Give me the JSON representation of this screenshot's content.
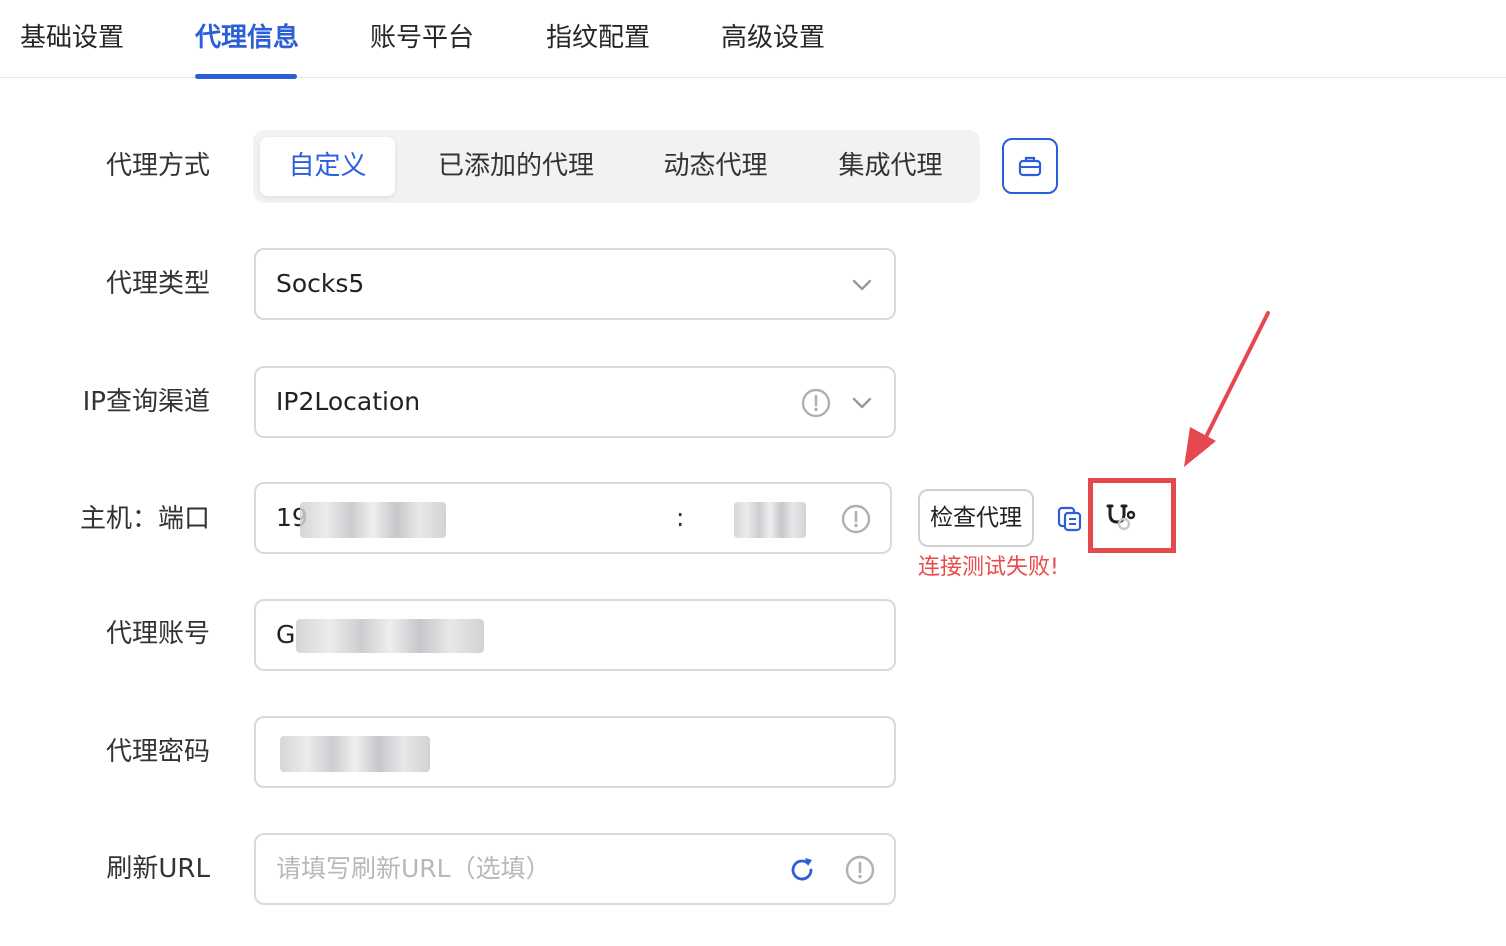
{
  "tabs": [
    {
      "label": "基础设置"
    },
    {
      "label": "代理信息"
    },
    {
      "label": "账号平台"
    },
    {
      "label": "指纹配置"
    },
    {
      "label": "高级设置"
    }
  ],
  "form": {
    "proxy_method": {
      "label": "代理方式",
      "options": [
        "自定义",
        "已添加的代理",
        "动态代理",
        "集成代理"
      ],
      "selected": "自定义"
    },
    "proxy_type": {
      "label": "代理类型",
      "value": "Socks5"
    },
    "ip_channel": {
      "label": "IP查询渠道",
      "value": "IP2Location"
    },
    "host_port": {
      "label": "主机：端口",
      "host_visible": "19",
      "separator": ":"
    },
    "proxy_account": {
      "label": "代理账号",
      "value_visible": "G"
    },
    "proxy_password": {
      "label": "代理密码"
    },
    "refresh_url": {
      "label": "刷新URL",
      "placeholder": "请填写刷新URL（选填）"
    }
  },
  "actions": {
    "check_proxy_label": "检查代理",
    "error_message": "连接测试失败!"
  },
  "colors": {
    "accent": "#2b5fd9",
    "error": "#ea4a4a",
    "annotation": "#e5484d"
  },
  "icons": [
    "briefcase-icon",
    "chevron-down-icon",
    "info-circle-icon",
    "copy-icon",
    "stethoscope-icon",
    "refresh-icon"
  ]
}
